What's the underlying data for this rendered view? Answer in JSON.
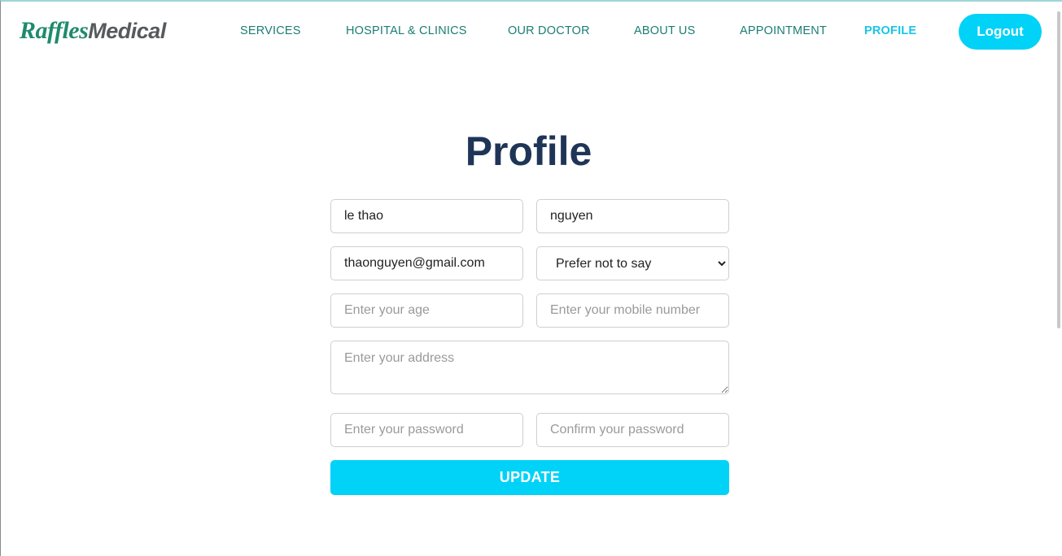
{
  "brand": {
    "part1": "Raffles",
    "part2": "Medical"
  },
  "nav": {
    "items": [
      "SERVICES",
      "HOSPITAL & CLINICS",
      "OUR DOCTOR",
      "ABOUT US",
      "APPOINTMENT",
      "PROFILE"
    ],
    "active": "PROFILE",
    "logout_label": "Logout"
  },
  "page": {
    "title": "Profile"
  },
  "form": {
    "first_name": {
      "value": "le thao",
      "placeholder": ""
    },
    "last_name": {
      "value": "nguyen",
      "placeholder": ""
    },
    "email": {
      "value": "thaonguyen@gmail.com",
      "placeholder": ""
    },
    "gender": {
      "selected": "Prefer not to say"
    },
    "age": {
      "value": "",
      "placeholder": "Enter your age"
    },
    "mobile": {
      "value": "",
      "placeholder": "Enter your mobile number"
    },
    "address": {
      "value": "",
      "placeholder": "Enter your address"
    },
    "password": {
      "value": "",
      "placeholder": "Enter your password"
    },
    "confirm_password": {
      "value": "",
      "placeholder": "Confirm your password"
    },
    "update_label": "UPDATE"
  },
  "colors": {
    "accent": "#00d2f8",
    "nav_text": "#1c7d74",
    "nav_active": "#19c6e6",
    "title": "#1f3557",
    "brand_green": "#1f8a6e",
    "brand_gray": "#555a5e"
  }
}
